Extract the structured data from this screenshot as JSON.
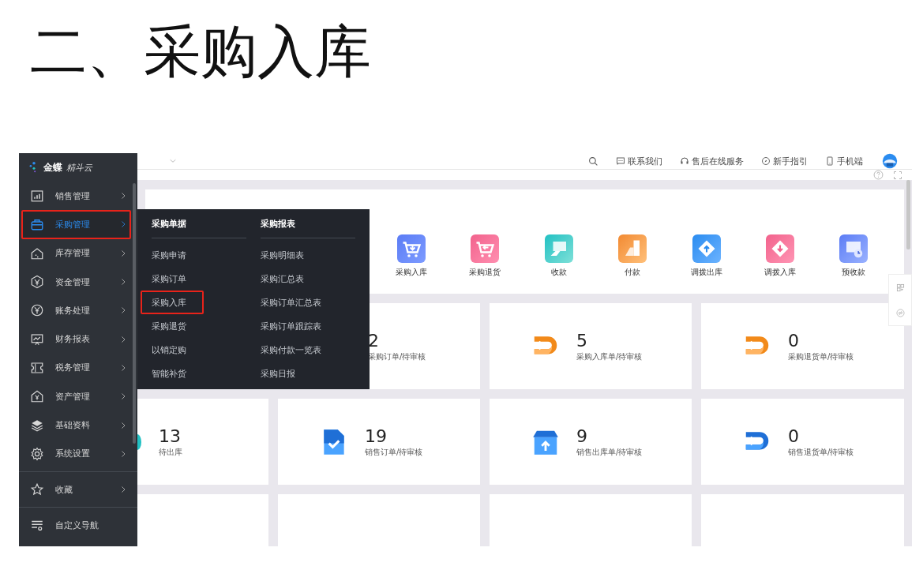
{
  "slide_title": "二、采购入库",
  "sidebar": {
    "logo_brand": "金蝶",
    "logo_product": "精斗云",
    "groups": [
      [
        {
          "label": "销售管理",
          "kind": "submenu",
          "selected": false,
          "highlighted": false
        },
        {
          "label": "采购管理",
          "kind": "submenu",
          "selected": true,
          "highlighted": true
        },
        {
          "label": "库存管理",
          "kind": "submenu",
          "selected": false,
          "highlighted": false
        },
        {
          "label": "资金管理",
          "kind": "submenu",
          "selected": false,
          "highlighted": false
        },
        {
          "label": "账务处理",
          "kind": "submenu",
          "selected": false,
          "highlighted": false
        },
        {
          "label": "财务报表",
          "kind": "submenu",
          "selected": false,
          "highlighted": false
        },
        {
          "label": "税务管理",
          "kind": "submenu",
          "selected": false,
          "highlighted": false
        },
        {
          "label": "资产管理",
          "kind": "submenu",
          "selected": false,
          "highlighted": false
        },
        {
          "label": "基础资料",
          "kind": "submenu",
          "selected": false,
          "highlighted": false
        },
        {
          "label": "系统设置",
          "kind": "submenu",
          "selected": false,
          "highlighted": false
        }
      ],
      [
        {
          "label": "收藏",
          "kind": "submenu",
          "selected": false,
          "highlighted": false
        }
      ],
      [
        {
          "label": "自定义导航",
          "kind": "action",
          "selected": false,
          "highlighted": false
        }
      ]
    ]
  },
  "topbar": {
    "actions": [
      {
        "label": "联系我们"
      },
      {
        "label": "售后在线服务"
      },
      {
        "label": "新手指引"
      },
      {
        "label": "手机端"
      }
    ]
  },
  "flyout": {
    "columns": [
      {
        "heading": "采购单据",
        "items": [
          {
            "label": "采购申请",
            "highlighted": false
          },
          {
            "label": "采购订单",
            "highlighted": false
          },
          {
            "label": "采购入库",
            "highlighted": true
          },
          {
            "label": "采购退货",
            "highlighted": false
          },
          {
            "label": "以销定购",
            "highlighted": false
          },
          {
            "label": "智能补货",
            "highlighted": false
          }
        ]
      },
      {
        "heading": "采购报表",
        "items": [
          {
            "label": "采购明细表",
            "highlighted": false
          },
          {
            "label": "采购汇总表",
            "highlighted": false
          },
          {
            "label": "采购订单汇总表",
            "highlighted": false
          },
          {
            "label": "采购订单跟踪表",
            "highlighted": false
          },
          {
            "label": "采购付款一览表",
            "highlighted": false
          },
          {
            "label": "采购日报",
            "highlighted": false
          }
        ]
      }
    ]
  },
  "quick_actions": [
    {
      "label": "采购入库"
    },
    {
      "label": "采购退货"
    },
    {
      "label": "收款"
    },
    {
      "label": "付款"
    },
    {
      "label": "调拨出库"
    },
    {
      "label": "调拨入库"
    },
    {
      "label": "预收款"
    }
  ],
  "stat_rows": [
    {
      "cards": [
        {
          "value": "2",
          "label": "采购订单/待审核"
        },
        {
          "value": "5",
          "label": "采购入库单/待审核"
        },
        {
          "value": "0",
          "label": "采购退货单/待审核"
        }
      ]
    },
    {
      "cards": [
        {
          "value": "13",
          "label": "待出库"
        },
        {
          "value": "19",
          "label": "销售订单/待审核"
        },
        {
          "value": "9",
          "label": "销售出库单/待审核"
        },
        {
          "value": "0",
          "label": "销售退货单/待审核"
        }
      ]
    }
  ]
}
